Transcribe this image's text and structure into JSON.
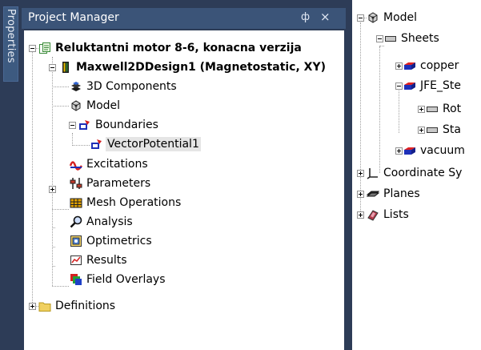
{
  "side_tab": {
    "label": "Properties"
  },
  "project_manager": {
    "title": "Project Manager",
    "pin_glyph": "ф",
    "close_glyph": "×",
    "tree": {
      "project": "Reluktantni motor 8-6, konacna verzija",
      "design": "Maxwell2DDesign1 (Magnetostatic, XY)",
      "items": {
        "components3d": "3D Components",
        "model": "Model",
        "boundaries": "Boundaries",
        "vector_potential": "VectorPotential1",
        "excitations": "Excitations",
        "parameters": "Parameters",
        "mesh_operations": "Mesh Operations",
        "analysis": "Analysis",
        "optimetrics": "Optimetrics",
        "results": "Results",
        "field_overlays": "Field Overlays",
        "definitions": "Definitions"
      }
    }
  },
  "model_tree": {
    "model": "Model",
    "sheets": "Sheets",
    "copper": "copper",
    "jfe_steel": "JFE_Ste",
    "rot": "Rot",
    "sta": "Sta",
    "vacuum": "vacuum",
    "coordinate_systems": "Coordinate Sy",
    "planes": "Planes",
    "lists": "Lists"
  },
  "colors": {
    "panel_bg": "#2d3c57",
    "header_bg": "#3b5478",
    "tree_bg": "#ffffff",
    "selection_bg": "#e5e5e5"
  }
}
